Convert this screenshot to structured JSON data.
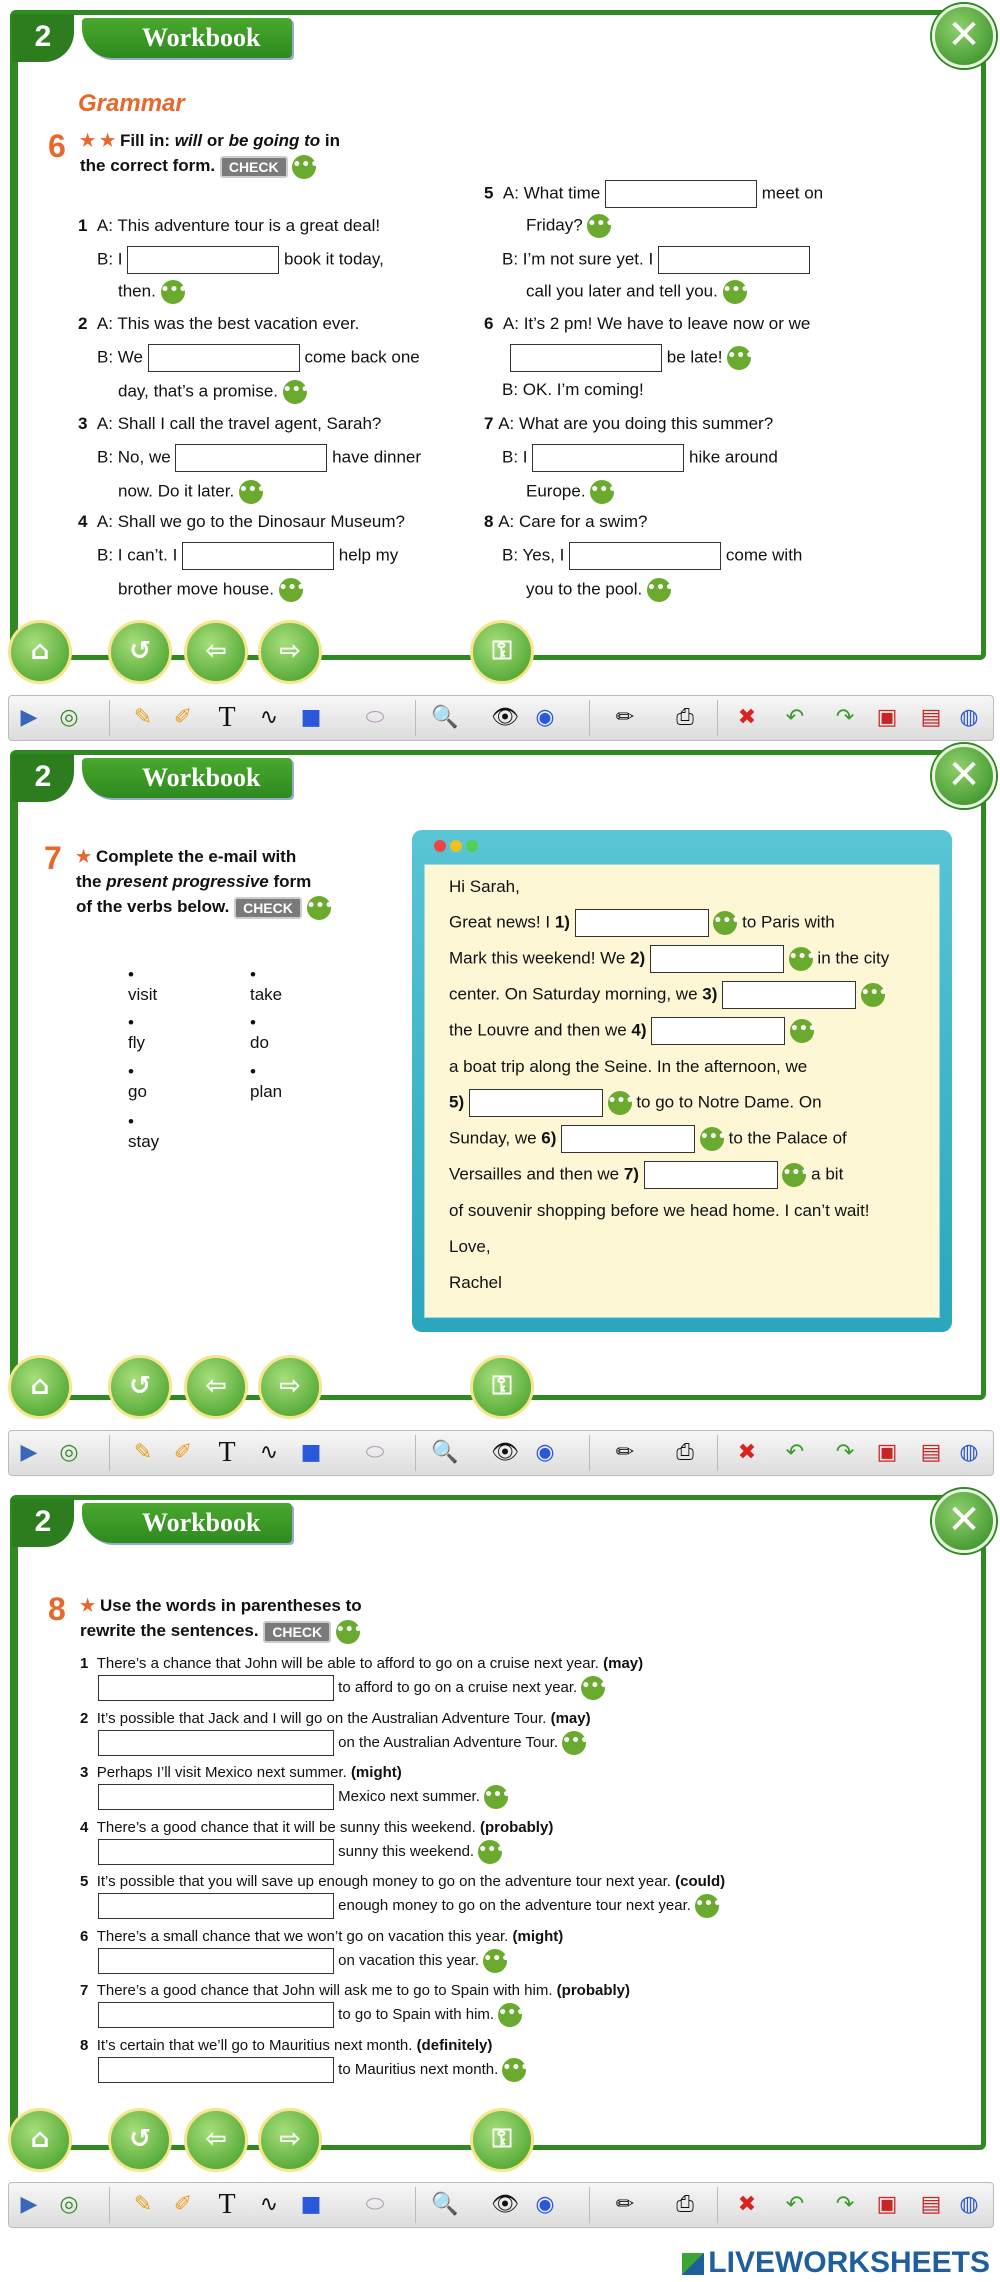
{
  "header": {
    "unit_number": "2",
    "tab_label": "Workbook",
    "close_icon": "close-icon"
  },
  "ex6": {
    "section_title": "Grammar",
    "number": "6",
    "stars": "★ ★",
    "instruction_1": "Fill in: ",
    "instruction_will": "will",
    "instruction_or": " or ",
    "instruction_bgt": "be going to",
    "instruction_in": " in",
    "instruction_2": "the correct form.",
    "check": "CHECK",
    "dots": "•••",
    "items": [
      {
        "n": "1",
        "a": "A: This adventure tour is a great deal!",
        "b_pre": "B: I",
        "b_post": "book it today,",
        "c": "then."
      },
      {
        "n": "2",
        "a": "A: This was the best vacation ever.",
        "b_pre": "B: We",
        "b_post": "come back one",
        "c": "day, that’s a promise."
      },
      {
        "n": "3",
        "a": "A: Shall I call the travel agent, Sarah?",
        "b_pre": "B: No, we",
        "b_post": "have dinner",
        "c": "now. Do it later."
      },
      {
        "n": "4",
        "a": "A: Shall we go to the Dinosaur Museum?",
        "b_pre": "B: I can’t. I",
        "b_post": "help my",
        "c": "brother move house."
      },
      {
        "n": "5",
        "a_pre": "A: What time",
        "a_post": "meet on",
        "a2": "Friday?",
        "b": "B: I’m not sure yet. I",
        "c": "call you  later and tell you."
      },
      {
        "n": "6",
        "a": "A: It’s 2 pm! We have to leave now or we",
        "a2_post": "be late!",
        "b": "B: OK. I’m coming!"
      },
      {
        "n": "7",
        "a": "A: What are you doing this summer?",
        "b_pre": "B: I",
        "b_post": "hike around",
        "c": "Europe."
      },
      {
        "n": "8",
        "a": "A: Care for a swim?",
        "b_pre": "B: Yes, I",
        "b_post": "come with",
        "c": "you to  the pool."
      }
    ]
  },
  "ex7": {
    "number": "7",
    "star": "★",
    "instr_1": "Complete the e-mail with",
    "instr_2a": "the ",
    "instr_2b": "present progressive",
    "instr_2c": " form",
    "instr_3": "of the verbs below.",
    "check": "CHECK",
    "verbs": [
      "visit",
      "take",
      "fly",
      "do",
      "go",
      "plan",
      "stay"
    ],
    "email": {
      "greeting": "Hi Sarah,",
      "l1a": "Great news! I ",
      "l1n": "1)",
      "l1b": "to Paris with",
      "l2a": "Mark this weekend! We ",
      "l2n": "2)",
      "l2b": "in the city",
      "l3a": "center. On Saturday morning, we ",
      "l3n": "3)",
      "l4a": "the Louvre and then we ",
      "l4n": "4)",
      "l5": "a boat trip along the Seine. In the afternoon, we",
      "l6n": "5)",
      "l6b": "to go to Notre Dame. On",
      "l7a": "Sunday, we ",
      "l7n": "6)",
      "l7b": "to the Palace of",
      "l8a": "Versailles and then we ",
      "l8n": "7)",
      "l8b": "a bit",
      "l9": "of souvenir shopping before we head home. I can’t wait!",
      "love": "Love,",
      "sign": "Rachel"
    }
  },
  "ex8": {
    "number": "8",
    "star": "★",
    "instr_1": "Use the words in parentheses to",
    "instr_2": "rewrite the sentences.",
    "check": "CHECK",
    "items": [
      {
        "n": "1",
        "s": "There’s a chance that John will be able to afford to go on a cruise next year.",
        "k": "(may)",
        "t": "to afford to go on a cruise next year."
      },
      {
        "n": "2",
        "s": "It’s possible that Jack and I will go on the Australian Adventure Tour.",
        "k": "(may)",
        "t": "on the Australian Adventure Tour."
      },
      {
        "n": "3",
        "s": "Perhaps I’ll visit Mexico next summer.",
        "k": "(might)",
        "t": "Mexico next summer."
      },
      {
        "n": "4",
        "s": "There’s a good chance that it will be sunny this weekend.",
        "k": "(probably)",
        "t": "sunny this weekend."
      },
      {
        "n": "5",
        "s": "It’s possible that you will save up enough money to go on the adventure tour next year.",
        "k": "(could)",
        "t": "enough money to go on the adventure tour next year."
      },
      {
        "n": "6",
        "s": "There’s a small chance that we won’t go on vacation this year.",
        "k": "(might)",
        "t": "on vacation this year."
      },
      {
        "n": "7",
        "s": "There’s a good chance that John will ask me to go to Spain with him.",
        "k": "(probably)",
        "t": "to go to Spain with him."
      },
      {
        "n": "8",
        "s": "It’s certain that we’ll go to Mauritius next month.",
        "k": "(definitely)",
        "t": "to Mauritius next month."
      }
    ]
  },
  "nav": {
    "home": "⌂",
    "back": "↺",
    "prev": "⇦",
    "next": "⇨",
    "key": "⚿"
  },
  "toolbar": {
    "play": "▶",
    "mouse": "◎",
    "pencil1": "✎",
    "pencil2": "✐",
    "text": "T",
    "curve": "∿",
    "square": "■",
    "eraser": "⬭",
    "zoom": "🔍",
    "eye1": "👁",
    "eye2": "◉",
    "note": "✏",
    "print": "⎙",
    "clear": "✖",
    "undo": "↶",
    "redo": "↷",
    "save1": "▣",
    "save2": "▤",
    "globe": "◍"
  },
  "footer": {
    "logo": "LIVEWORKSHEETS"
  },
  "colors": {
    "green": "#2f8a21",
    "orange": "#e8672a",
    "email_bg": "#fdf7d6"
  }
}
